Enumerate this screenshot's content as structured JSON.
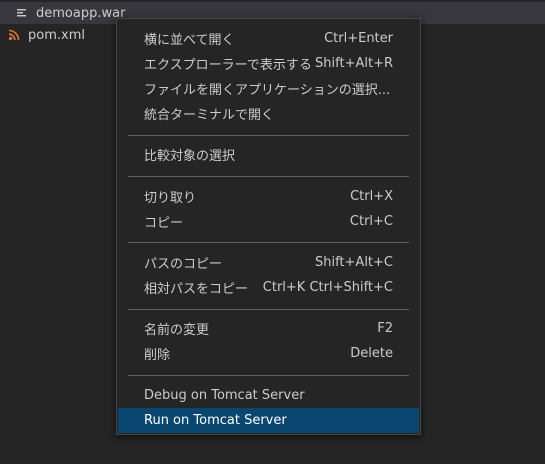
{
  "explorer": {
    "files": [
      {
        "name": "demoapp.war",
        "icon": "file-lines-icon"
      },
      {
        "name": "pom.xml",
        "icon": "rss-icon"
      }
    ]
  },
  "context_menu": {
    "items": [
      {
        "label": "横に並べて開く",
        "keybinding": "Ctrl+Enter"
      },
      {
        "label": "エクスプローラーで表示する",
        "keybinding": "Shift+Alt+R"
      },
      {
        "label": "ファイルを開くアプリケーションの選択...",
        "keybinding": ""
      },
      {
        "label": "統合ターミナルで開く",
        "keybinding": ""
      },
      {
        "label": "比較対象の選択",
        "keybinding": ""
      },
      {
        "label": "切り取り",
        "keybinding": "Ctrl+X"
      },
      {
        "label": "コピー",
        "keybinding": "Ctrl+C"
      },
      {
        "label": "パスのコピー",
        "keybinding": "Shift+Alt+C"
      },
      {
        "label": "相対パスをコピー",
        "keybinding": "Ctrl+K Ctrl+Shift+C"
      },
      {
        "label": "名前の変更",
        "keybinding": "F2"
      },
      {
        "label": "削除",
        "keybinding": "Delete"
      },
      {
        "label": "Debug on Tomcat Server",
        "keybinding": ""
      },
      {
        "label": "Run on Tomcat Server",
        "keybinding": ""
      }
    ]
  },
  "colors": {
    "background": "#252526",
    "selection": "#094771",
    "tree_selected": "#37373d",
    "rss_icon": "#e37933",
    "text": "#cccccc"
  }
}
